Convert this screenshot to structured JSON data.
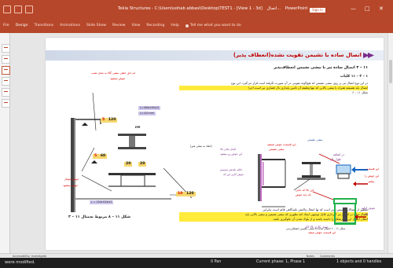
{
  "window": {
    "title": "Tekla Structures - C:\\Users\\sohab abbasi\\Desktop\\TEST1 - [View 1 - 3d]",
    "app_suffix": "PowerPoint",
    "title_left": "اتصال...",
    "signin": "Sign in",
    "controls": [
      "—",
      "□",
      "✕"
    ]
  },
  "ribbon": {
    "tabs": [
      "File",
      "Design",
      "Transitions",
      "Animations",
      "Slide Show",
      "Review",
      "View",
      "Recording",
      "Help"
    ],
    "tellme": "Tell me what you want to do"
  },
  "slide": {
    "title": "اتصال ساده با نشیمن تقویت نشده(انعطاف پذیر)",
    "section_heading": "۱۱ – ۳ اتصال ساده تیر با نبشی نشیمن انعطاف‌پذیر",
    "sub_heading": "۱ – ۳ – ۱۱ کلیات",
    "para1_line1": "در این نوع اتصال تیر بر روی نبشی نشیمن که هیچ‌گونه تقویتی در آن صورت نگرفته است قرار می‌گیرد. این نوع",
    "para1_line2": "اتصال باید همیشه همراه با نبشی بالایی که تنها وظیفه آن تأمین پایداری بال فشاری تیر است اجرا",
    "para1_line3": "شکل ۱۱ – ۶",
    "para2_line1": "منظور از اتصالات نشیمن، این است که نها انتقال واکنش تکیه‌گاهی قائم است بنابراین",
    "para2_line2": "اتصال سایه در انتهای تیر گیرداری قابل توجیهی ایجاد کند بطوری که نبشی نشیمن و نبشی بالایی باید",
    "para2_line3": "امکان انتقال این تغییرشکل را داشته باشند و از بلوک شدن آن جلوگیری نکنند.",
    "figure_caption": "شکل ۱۱ – ۸  مربوط به‌مثال ۱۱ – ۳",
    "right_fig_caption": "شکل ۱۱ – ۶  اتصال ساده با نبشی نشیمن انعطاف‌پذیر",
    "dims": {
      "top": {
        "num": "5",
        "size": "120"
      },
      "mid": {
        "num": "5",
        "size": "60"
      },
      "w20a": "20",
      "w20b": "20",
      "bot": {
        "num": "10",
        "size": "120"
      }
    },
    "plates": {
      "p1": "L=160x100x12",
      "p2": "L=120 mm",
      "p3": "L = 120x120x12",
      "ipe": "IPE",
      "fig_note": "(ابعاد به میلی متر)"
    },
    "annotations": {
      "top_left": "ایه دای خطی نبشی گالا به محل نصب",
      "top_left2": "جوش میشود",
      "left_mid1": "جوش مونتاژ",
      "left_mid2": "جوش میشود",
      "mid1": "المان مالی بالا",
      "mid2": "این جوش رو میشود",
      "mid3": "قالبه بلندش نیمسیم",
      "mid4": "جوش کاری این که",
      "right1": "این قسمت جوش نمیشه",
      "right2": "نبشی نشیمن",
      "right3": "این بالا که جایی",
      "right4": "که باید جوش",
      "right5": "نبشی نشیمن",
      "right6": "جوش کاری بالا کام",
      "right7": "این قسمت جوش میشه",
      "right8": "طول بال",
      "right9": "در اضافه",
      "far1": "این قسمت",
      "far2": "این جوش را",
      "far3": "بیشتر",
      "far4": "جوش اولیه",
      "far5": "بالا"
    }
  },
  "notes_bar": {
    "left": "Accessibility: Investigate",
    "right_notes": "Notes",
    "right_comments": "Comments"
  },
  "status": {
    "left": "were modified.",
    "mid": "0   Pan",
    "phase": "Current phase: 1, Phase 1",
    "right": "1 objects and 0 handles"
  },
  "colors": {
    "accent": "#b7472a",
    "title_red": "#c00000",
    "highlight": "#ffeb3b",
    "dim_fill": "#f5d76e",
    "plate_fill": "#cfc7ee",
    "annot_blue": "#2a4ea0",
    "annot_purple": "#7a2c8a",
    "green": "#22b14c"
  }
}
